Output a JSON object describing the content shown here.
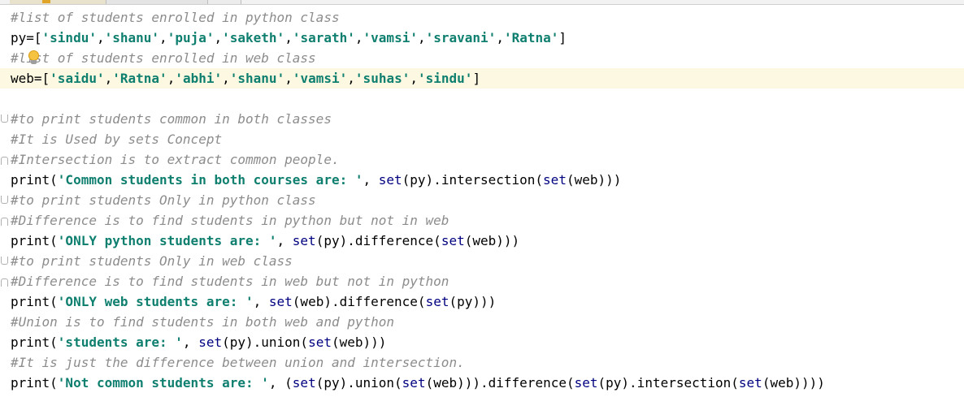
{
  "editor": {
    "lines": [
      {
        "segments": [
          {
            "t": "comment",
            "v": "#list of students enrolled in python class"
          }
        ]
      },
      {
        "segments": [
          {
            "t": "plain",
            "v": "py=["
          },
          {
            "t": "str",
            "v": "'sindu'"
          },
          {
            "t": "plain",
            "v": ","
          },
          {
            "t": "str",
            "v": "'shanu'"
          },
          {
            "t": "plain",
            "v": ","
          },
          {
            "t": "str",
            "v": "'puja'"
          },
          {
            "t": "plain",
            "v": ","
          },
          {
            "t": "str",
            "v": "'saketh'"
          },
          {
            "t": "plain",
            "v": ","
          },
          {
            "t": "str",
            "v": "'sarath'"
          },
          {
            "t": "plain",
            "v": ","
          },
          {
            "t": "str",
            "v": "'vamsi'"
          },
          {
            "t": "plain",
            "v": ","
          },
          {
            "t": "str",
            "v": "'sravani'"
          },
          {
            "t": "plain",
            "v": ","
          },
          {
            "t": "str",
            "v": "'Ratna'"
          },
          {
            "t": "plain",
            "v": "]"
          }
        ]
      },
      {
        "segments": [
          {
            "t": "comment",
            "v": "#list of students enrolled in web class"
          }
        ],
        "bulb": true
      },
      {
        "segments": [
          {
            "t": "plain",
            "v": "web=["
          },
          {
            "t": "str",
            "v": "'saidu'"
          },
          {
            "t": "plain",
            "v": ","
          },
          {
            "t": "str",
            "v": "'Ratna'"
          },
          {
            "t": "plain",
            "v": ","
          },
          {
            "t": "str",
            "v": "'abhi'"
          },
          {
            "t": "plain",
            "v": ","
          },
          {
            "t": "str",
            "v": "'shanu'"
          },
          {
            "t": "plain",
            "v": ","
          },
          {
            "t": "str",
            "v": "'vamsi'"
          },
          {
            "t": "plain",
            "v": ","
          },
          {
            "t": "str",
            "v": "'suhas'"
          },
          {
            "t": "plain",
            "v": ","
          },
          {
            "t": "str",
            "v": "'sindu'"
          },
          {
            "t": "plain",
            "v": "]"
          }
        ],
        "current": true
      },
      {
        "segments": []
      },
      {
        "segments": [
          {
            "t": "comment",
            "v": "#to print students common in both classes"
          }
        ],
        "fold": "down"
      },
      {
        "segments": [
          {
            "t": "comment",
            "v": "#It is Used by sets Concept"
          }
        ]
      },
      {
        "segments": [
          {
            "t": "comment",
            "v": "#Intersection is to extract common people."
          }
        ],
        "fold": "up"
      },
      {
        "segments": [
          {
            "t": "plain",
            "v": "print("
          },
          {
            "t": "str",
            "v": "'Common students in both courses are: '"
          },
          {
            "t": "plain",
            "v": ", "
          },
          {
            "t": "builtin",
            "v": "set"
          },
          {
            "t": "plain",
            "v": "(py).intersection("
          },
          {
            "t": "builtin",
            "v": "set"
          },
          {
            "t": "plain",
            "v": "(web)))"
          }
        ]
      },
      {
        "segments": [
          {
            "t": "comment",
            "v": "#to print students Only in python class"
          }
        ],
        "fold": "down"
      },
      {
        "segments": [
          {
            "t": "comment",
            "v": "#Difference is to find students in python but not in web"
          }
        ],
        "fold": "up"
      },
      {
        "segments": [
          {
            "t": "plain",
            "v": "print("
          },
          {
            "t": "str",
            "v": "'ONLY python students are: '"
          },
          {
            "t": "plain",
            "v": ", "
          },
          {
            "t": "builtin",
            "v": "set"
          },
          {
            "t": "plain",
            "v": "(py).difference("
          },
          {
            "t": "builtin",
            "v": "set"
          },
          {
            "t": "plain",
            "v": "(web)))"
          }
        ]
      },
      {
        "segments": [
          {
            "t": "comment",
            "v": "#to print students Only in web class"
          }
        ],
        "fold": "down"
      },
      {
        "segments": [
          {
            "t": "comment",
            "v": "#Difference is to find students in web but not in python"
          }
        ],
        "fold": "up"
      },
      {
        "segments": [
          {
            "t": "plain",
            "v": "print("
          },
          {
            "t": "str",
            "v": "'ONLY web students are: '"
          },
          {
            "t": "plain",
            "v": ", "
          },
          {
            "t": "builtin",
            "v": "set"
          },
          {
            "t": "plain",
            "v": "(web).difference("
          },
          {
            "t": "builtin",
            "v": "set"
          },
          {
            "t": "plain",
            "v": "(py)))"
          }
        ]
      },
      {
        "segments": [
          {
            "t": "comment",
            "v": "#Union is to find students in both web and python"
          }
        ]
      },
      {
        "segments": [
          {
            "t": "plain",
            "v": "print("
          },
          {
            "t": "str",
            "v": "'students are: '"
          },
          {
            "t": "plain",
            "v": ", "
          },
          {
            "t": "builtin",
            "v": "set"
          },
          {
            "t": "plain",
            "v": "(py).union("
          },
          {
            "t": "builtin",
            "v": "set"
          },
          {
            "t": "plain",
            "v": "(web)))"
          }
        ]
      },
      {
        "segments": [
          {
            "t": "comment",
            "v": "#It is just the difference between union and intersection."
          }
        ]
      },
      {
        "segments": [
          {
            "t": "plain",
            "v": "print("
          },
          {
            "t": "str",
            "v": "'Not common students are: '"
          },
          {
            "t": "plain",
            "v": ", ("
          },
          {
            "t": "builtin",
            "v": "set"
          },
          {
            "t": "plain",
            "v": "(py).union("
          },
          {
            "t": "builtin",
            "v": "set"
          },
          {
            "t": "plain",
            "v": "(web))).difference("
          },
          {
            "t": "builtin",
            "v": "set"
          },
          {
            "t": "plain",
            "v": "(py).intersection("
          },
          {
            "t": "builtin",
            "v": "set"
          },
          {
            "t": "plain",
            "v": "(web))))"
          }
        ]
      }
    ]
  },
  "colors": {
    "comment": "#8c8c8c",
    "string": "#0f7f6f",
    "builtin": "#000080",
    "current_line": "#fcf8e1"
  },
  "icons": {
    "intention": "lightbulb-icon"
  }
}
